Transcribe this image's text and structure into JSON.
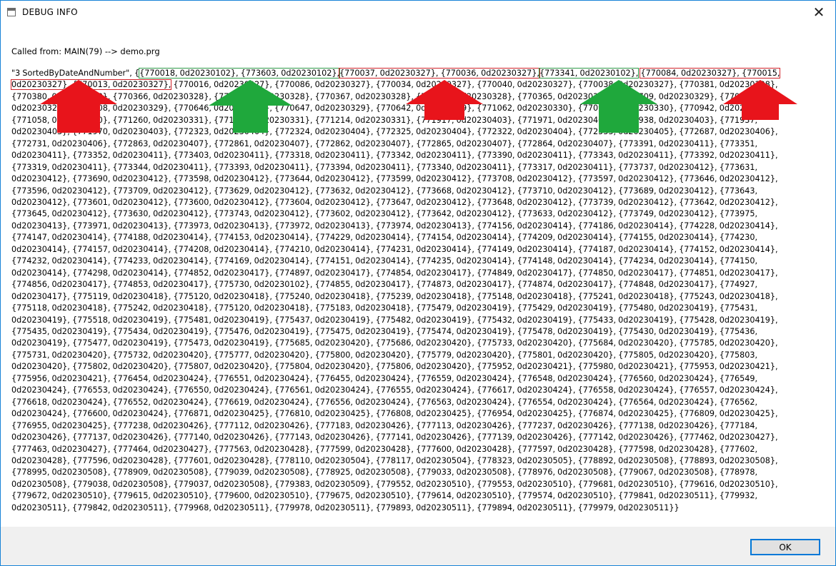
{
  "window": {
    "title": "DEBUG INFO",
    "close_glyph": "✕"
  },
  "message": {
    "called_from": "Called from: MAIN(79) --> demo.prg",
    "prefix": "\"3 SortedByDateAndNumber\", {",
    "hl_green_1": "{770018, 0d20230102}, {773603, 0d20230102},",
    "hl_red_1": "{770037, 0d20230327}, {770036, 0d20230327},",
    "hl_green_2": "{773341, 0d20230102},",
    "hl_red_2a": "{770084, 0d20230327}, {770015,",
    "hl_red_2b": "0d20230327}, {770013, 0d20230327},",
    "rest": " {770016, 0d20230327}, {770086, 0d20230327}, {770034, 0d20230327}, {770040, 0d20230327}, {770038, 0d20230327}, {770381, 0d20230328}, {770380, 0d20230328}, {770366, 0d20230328}, {770368, 0d20230328}, {770367, 0d20230328}, {770364, 0d20230328}, {770365, 0d20230328}, {770709, 0d20230329}, {770711, 0d20230329}, {770708, 0d20230329}, {770646, 0d20230329}, {770647, 0d20230329}, {770642, 0d20230329}, {771062, 0d20230330}, {770943, 0d20230330}, {770942, 0d20230330}, {771058, 0d20230330}, {771260, 0d20230331}, {771261, 0d20230331}, {771214, 0d20230331}, {771917, 0d20230403}, {771971, 0d20230403}, {771938, 0d20230403}, {771937, 0d20230403}, {771970, 0d20230403}, {772323, 0d20230404}, {772324, 0d20230404}, {772325, 0d20230404}, {772322, 0d20230404}, {772533, 0d20230405}, {772687, 0d20230406}, {772731, 0d20230406}, {772863, 0d20230407}, {772861, 0d20230407}, {772862, 0d20230407}, {772865, 0d20230407}, {772864, 0d20230407}, {773391, 0d20230411}, {773351, 0d20230411}, {773352, 0d20230411}, {773403, 0d20230411}, {773318, 0d20230411}, {773342, 0d20230411}, {773390, 0d20230411}, {773343, 0d20230411}, {773392, 0d20230411}, {773319, 0d20230411}, {773344, 0d20230411}, {773393, 0d20230411}, {773394, 0d20230411}, {773340, 0d20230411}, {773317, 0d20230411}, {773737, 0d20230412}, {773631, 0d20230412}, {773690, 0d20230412}, {773598, 0d20230412}, {773644, 0d20230412}, {773599, 0d20230412}, {773708, 0d20230412}, {773597, 0d20230412}, {773646, 0d20230412}, {773596, 0d20230412}, {773709, 0d20230412}, {773629, 0d20230412}, {773632, 0d20230412}, {773668, 0d20230412}, {773710, 0d20230412}, {773689, 0d20230412}, {773643, 0d20230412}, {773601, 0d20230412}, {773600, 0d20230412}, {773604, 0d20230412}, {773647, 0d20230412}, {773648, 0d20230412}, {773739, 0d20230412}, {773642, 0d20230412}, {773645, 0d20230412}, {773630, 0d20230412}, {773743, 0d20230412}, {773602, 0d20230412}, {773642, 0d20230412}, {773633, 0d20230412}, {773749, 0d20230412}, {773975, 0d20230413}, {773971, 0d20230413}, {773973, 0d20230413}, {773972, 0d20230413}, {773974, 0d20230413}, {774156, 0d20230414}, {774186, 0d20230414}, {774228, 0d20230414}, {774147, 0d20230414}, {774188, 0d20230414}, {774153, 0d20230414}, {774229, 0d20230414}, {774154, 0d20230414}, {774209, 0d20230414}, {774155, 0d20230414}, {774230, 0d20230414}, {774157, 0d20230414}, {774208, 0d20230414}, {774210, 0d20230414}, {774231, 0d20230414}, {774149, 0d20230414}, {774187, 0d20230414}, {774152, 0d20230414}, {774232, 0d20230414}, {774233, 0d20230414}, {774169, 0d20230414}, {774151, 0d20230414}, {774235, 0d20230414}, {774148, 0d20230414}, {774234, 0d20230414}, {774150, 0d20230414}, {774298, 0d20230414}, {774852, 0d20230417}, {774897, 0d20230417}, {774854, 0d20230417}, {774849, 0d20230417}, {774850, 0d20230417}, {774851, 0d20230417}, {774856, 0d20230417}, {774853, 0d20230417}, {775730, 0d20230102}, {774855, 0d20230417}, {774873, 0d20230417}, {774874, 0d20230417}, {774848, 0d20230417}, {774927, 0d20230417}, {775119, 0d20230418}, {775120, 0d20230418}, {775240, 0d20230418}, {775239, 0d20230418}, {775148, 0d20230418}, {775241, 0d20230418}, {775243, 0d20230418}, {775118, 0d20230418}, {775242, 0d20230418}, {775120, 0d20230418}, {775183, 0d20230418}, {775479, 0d20230419}, {775429, 0d20230419}, {775480, 0d20230419}, {775431, 0d20230419}, {775518, 0d20230419}, {775481, 0d20230419}, {775437, 0d20230419}, {775482, 0d20230419}, {775432, 0d20230419}, {775433, 0d20230419}, {775428, 0d20230419}, {775435, 0d20230419}, {775434, 0d20230419}, {775476, 0d20230419}, {775475, 0d20230419}, {775474, 0d20230419}, {775478, 0d20230419}, {775430, 0d20230419}, {775436, 0d20230419}, {775477, 0d20230419}, {775473, 0d20230419}, {775685, 0d20230420}, {775686, 0d20230420}, {775733, 0d20230420}, {775684, 0d20230420}, {775785, 0d20230420}, {775731, 0d20230420}, {775732, 0d20230420}, {775777, 0d20230420}, {775800, 0d20230420}, {775779, 0d20230420}, {775801, 0d20230420}, {775805, 0d20230420}, {775803, 0d20230420}, {775802, 0d20230420}, {775807, 0d20230420}, {775804, 0d20230420}, {775806, 0d20230420}, {775952, 0d20230421}, {775980, 0d20230421}, {775953, 0d20230421}, {775956, 0d20230421}, {776454, 0d20230424}, {776551, 0d20230424}, {776455, 0d20230424}, {776559, 0d20230424}, {776548, 0d20230424}, {776560, 0d20230424}, {776549, 0d20230424}, {776553, 0d20230424}, {776550, 0d20230424}, {776561, 0d20230424}, {776555, 0d20230424}, {776617, 0d20230424}, {776558, 0d20230424}, {776557, 0d20230424}, {776618, 0d20230424}, {776552, 0d20230424}, {776619, 0d20230424}, {776556, 0d20230424}, {776563, 0d20230424}, {776554, 0d20230424}, {776564, 0d20230424}, {776562, 0d20230424}, {776600, 0d20230424}, {776871, 0d20230425}, {776810, 0d20230425}, {776808, 0d20230425}, {776954, 0d20230425}, {776874, 0d20230425}, {776809, 0d20230425}, {776955, 0d20230425}, {777238, 0d20230426}, {777112, 0d20230426}, {777183, 0d20230426}, {777113, 0d20230426}, {777237, 0d20230426}, {777138, 0d20230426}, {777184, 0d20230426}, {777137, 0d20230426}, {777140, 0d20230426}, {777143, 0d20230426}, {777141, 0d20230426}, {777139, 0d20230426}, {777142, 0d20230426}, {777462, 0d20230427}, {777463, 0d20230427}, {777464, 0d20230427}, {777563, 0d20230428}, {777599, 0d20230428}, {777600, 0d20230428}, {777597, 0d20230428}, {777598, 0d20230428}, {777602, 0d20230428}, {777596, 0d20230428}, {777601, 0d20230428}, {778110, 0d20230504}, {778117, 0d20230504}, {778323, 0d20230505}, {778892, 0d20230508}, {778893, 0d20230508}, {778995, 0d20230508}, {778909, 0d20230508}, {779039, 0d20230508}, {778925, 0d20230508}, {779033, 0d20230508}, {778976, 0d20230508}, {779067, 0d20230508}, {778978, 0d20230508}, {779038, 0d20230508}, {779037, 0d20230508}, {779383, 0d20230509}, {779552, 0d20230510}, {779553, 0d20230510}, {779681, 0d20230510}, {779616, 0d20230510}, {779672, 0d20230510}, {779615, 0d20230510}, {779600, 0d20230510}, {779675, 0d20230510}, {779614, 0d20230510}, {779574, 0d20230510}, {779841, 0d20230511}, {779932, 0d20230511}, {779842, 0d20230511}, {779968, 0d20230511}, {779978, 0d20230511}, {779893, 0d20230511}, {779894, 0d20230511}, {779979, 0d20230511}}"
  },
  "buttons": {
    "ok_label": "OK"
  },
  "colors": {
    "arrow_red": "#e8141b",
    "arrow_green": "#1fa83c",
    "hl_green": "#2f9b4a",
    "hl_red": "#d2232a",
    "accent": "#0078d7"
  }
}
